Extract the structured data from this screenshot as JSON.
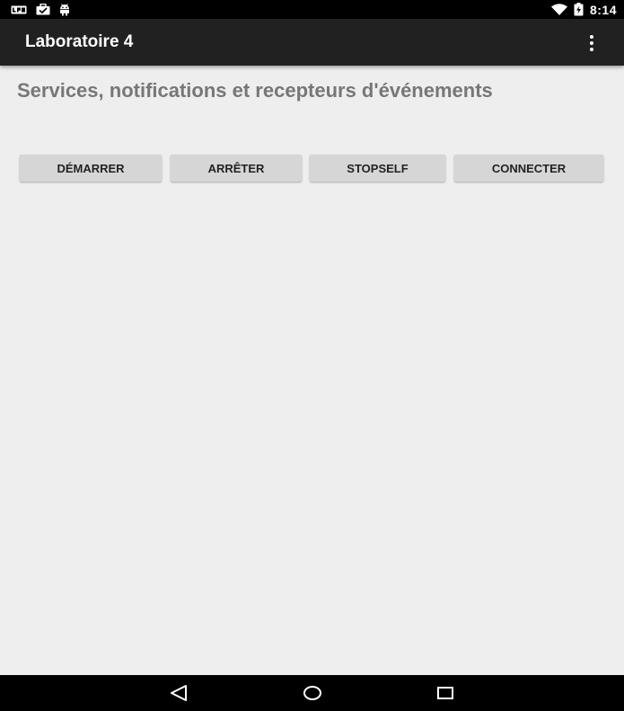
{
  "status_bar": {
    "time": "8:14",
    "left_icons": [
      "lp-icon",
      "briefcase-icon",
      "android-icon"
    ],
    "right_icons": [
      "wifi-icon",
      "battery-charging-icon"
    ]
  },
  "app_bar": {
    "title": "Laboratoire 4",
    "menu_icon": "overflow-menu-icon"
  },
  "main": {
    "heading": "Services, notifications et recepteurs d'événements",
    "buttons": [
      {
        "label": "DÉMARRER"
      },
      {
        "label": "ARRÊTER"
      },
      {
        "label": "STOPSELF"
      },
      {
        "label": "CONNECTER"
      }
    ]
  },
  "nav_bar": {
    "icons": [
      "back-icon",
      "home-icon",
      "recents-icon"
    ]
  },
  "colors": {
    "status_bar": "#000000",
    "app_bar": "#212121",
    "background": "#eeeeee",
    "heading": "#777777",
    "button_bg": "#d6d6d6",
    "button_text": "#222222"
  }
}
